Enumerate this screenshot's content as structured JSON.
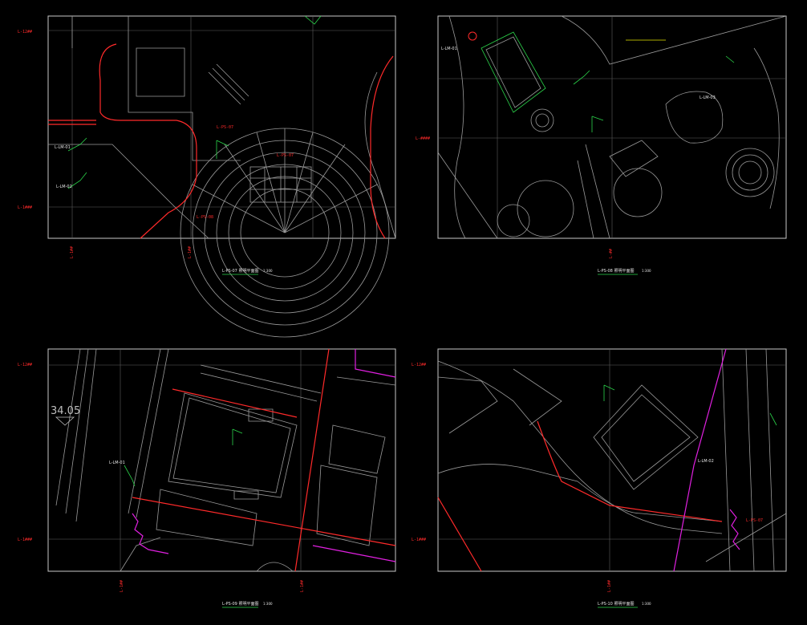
{
  "colors": {
    "background": "#000000",
    "frame": "#c8c8c8",
    "linework": "#8a8a8a",
    "accent_red": "#ff2a2a",
    "accent_green": "#2bd44a",
    "accent_magenta": "#e020e0",
    "accent_cyan": "#20d0e0",
    "accent_yellow": "#e6e600"
  },
  "panels": [
    {
      "grid_top": "L-12##",
      "grid_bottom": "L-1###",
      "axis_below": "L-1##",
      "axis_below_2": "",
      "title": "L-PS-07 照明平面图",
      "scale": "1:300",
      "elevation": ""
    },
    {
      "grid_top": "",
      "grid_bottom": "L-####",
      "axis_below": "L-##",
      "axis_below_2": "",
      "title": "L-PS-08 照明平面图",
      "scale": "1:300",
      "elevation": ""
    },
    {
      "grid_top": "L-12##",
      "grid_bottom": "L-1###",
      "axis_below": "L-1##",
      "axis_below_2": "L-1##",
      "title": "L-PS-09 照明平面图",
      "scale": "1:300",
      "elevation": "34.05"
    },
    {
      "grid_top": "L-12##",
      "grid_bottom": "L-1###",
      "axis_below": "L-1##",
      "axis_below_2": "",
      "title": "L-PS-10 照明平面图",
      "scale": "1:300",
      "elevation": ""
    }
  ]
}
